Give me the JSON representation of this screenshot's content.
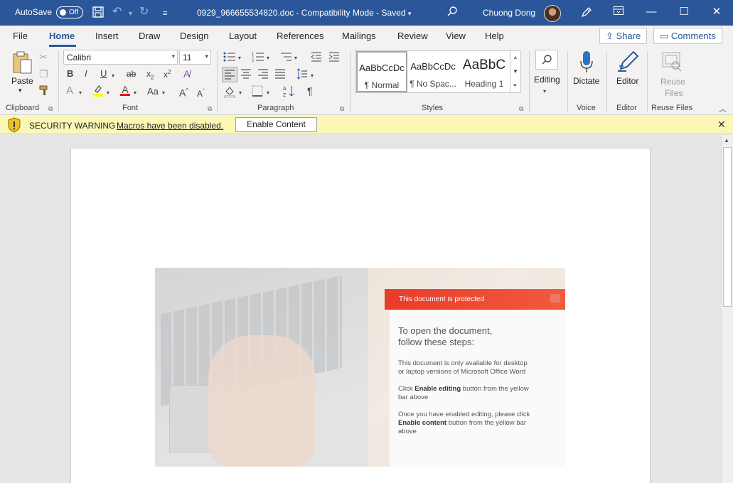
{
  "titlebar": {
    "autosave_label": "AutoSave",
    "autosave_state": "Off",
    "title": "0929_966655534820.doc  -  Compatibility Mode  -  Saved",
    "title_caret": "▾",
    "user": "Chuong Dong"
  },
  "tabs": [
    "File",
    "Home",
    "Insert",
    "Draw",
    "Design",
    "Layout",
    "References",
    "Mailings",
    "Review",
    "View",
    "Help"
  ],
  "share_label": "Share",
  "comments_label": "Comments",
  "ribbon": {
    "clipboard": {
      "paste_label": "Paste",
      "group_label": "Clipboard"
    },
    "font": {
      "font_name": "Calibri",
      "font_size": "11",
      "group_label": "Font"
    },
    "paragraph": {
      "group_label": "Paragraph"
    },
    "styles": {
      "group_label": "Styles",
      "items": [
        {
          "preview": "AaBbCcDc",
          "name": "¶ Normal"
        },
        {
          "preview": "AaBbCcDc",
          "name": "¶ No Spac..."
        },
        {
          "preview": "AaBbC",
          "name": "Heading 1"
        }
      ]
    },
    "editing_label": "Editing",
    "voice": {
      "dictate_label": "Dictate",
      "group_label": "Voice"
    },
    "editor": {
      "editor_label": "Editor",
      "group_label": "Editor"
    },
    "reuse": {
      "label_line1": "Reuse",
      "label_line2": "Files",
      "group_label": "Reuse Files"
    }
  },
  "security": {
    "title": "SECURITY WARNING",
    "message": "Macros have been disabled.",
    "button": "Enable Content"
  },
  "lure": {
    "banner": "This document is protected",
    "heading_line1": "To open the document,",
    "heading_line2": "follow these steps:",
    "p1_line1": "This document is only available for desktop",
    "p1_line2": "or laptop versions of Microsoft Office Word",
    "p2_pre": "Click ",
    "p2_bold": "Enable editing",
    "p2_post": " button from the yellow",
    "p2_line2": "bar above",
    "p3_line1": "Once you have enabled editing, please click",
    "p3_bold": "Enable content",
    "p3_post": " button from the yellow bar",
    "p3_line3": "above"
  },
  "colors": {
    "accent": "#2b579a",
    "warning_bar": "#fcf7b6",
    "banner_red": "#e93b2a"
  }
}
